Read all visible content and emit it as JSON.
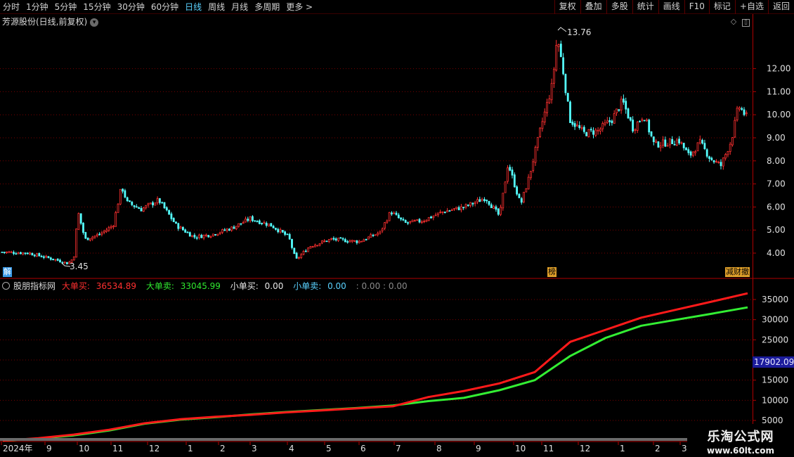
{
  "toolbar": {
    "periods": [
      {
        "label": "分时"
      },
      {
        "label": "1分钟"
      },
      {
        "label": "5分钟"
      },
      {
        "label": "15分钟"
      },
      {
        "label": "30分钟"
      },
      {
        "label": "60分钟"
      },
      {
        "label": "日线",
        "active": true
      },
      {
        "label": "周线"
      },
      {
        "label": "月线"
      },
      {
        "label": "多周期"
      },
      {
        "label": "更多 >"
      }
    ],
    "tools": [
      "复权",
      "叠加",
      "多股",
      "统计",
      "画线",
      "F10",
      "标记",
      "+自选",
      "返回"
    ]
  },
  "price_pane": {
    "title": "芳源股份(日线,前复权)",
    "high_label": "13.76",
    "low_label": "3.45",
    "y_ticks": [
      "12.00",
      "11.00",
      "10.00",
      "9.00",
      "8.00",
      "7.00",
      "6.00",
      "5.00",
      "4.00"
    ],
    "badges": {
      "left": "解",
      "mid": "榜",
      "right": "减财撤"
    }
  },
  "indicator_pane": {
    "name": "股朋指标网",
    "items": [
      {
        "label": "大单买:",
        "value": "36534.89",
        "color": "red"
      },
      {
        "label": "大单卖:",
        "value": "33045.99",
        "color": "green"
      },
      {
        "label": "小单买:",
        "value": "0.00",
        "color": "yellow"
      },
      {
        "label": "小单卖:",
        "value": "0.00",
        "color": "cyan"
      }
    ],
    "extra": ": 0.00  : 0.00",
    "y_ticks": [
      "35000",
      "30000",
      "25000",
      "20000",
      "15000",
      "10000",
      "5000"
    ],
    "highlight_value": "17902.09"
  },
  "x_axis": {
    "labels": [
      "2024年",
      "9",
      "10",
      "11",
      "12",
      "1",
      "2",
      "3",
      "4",
      "5",
      "6",
      "7",
      "8",
      "9",
      "10",
      "11",
      "12",
      "1",
      "2",
      "3"
    ]
  },
  "watermark": {
    "title": "乐淘公式网",
    "url": "www.60lt.com"
  },
  "colors": {
    "up": "#ff3030",
    "down": "#54ffff",
    "buy_line": "#ff1a1a",
    "sell_line": "#33ee33",
    "grid": "#7a0000",
    "axis": "#b00000",
    "highlight": "#1c1c9c"
  },
  "chart_data": {
    "type": "line",
    "series": [
      {
        "name": "大单买",
        "values": [
          0,
          600,
          1500,
          2700,
          4300,
          5300,
          5900,
          6400,
          7000,
          7500,
          8000,
          8500,
          10800,
          12300,
          14200,
          17000,
          24500,
          27500,
          30500,
          32500,
          34500,
          36535
        ]
      },
      {
        "name": "大单卖",
        "values": [
          0,
          500,
          1300,
          2500,
          4200,
          5200,
          5800,
          6500,
          7100,
          7600,
          8100,
          8700,
          9800,
          10600,
          12500,
          15000,
          21000,
          25500,
          28500,
          30000,
          31500,
          33046
        ]
      }
    ],
    "ylim": [
      0,
      37500
    ]
  }
}
